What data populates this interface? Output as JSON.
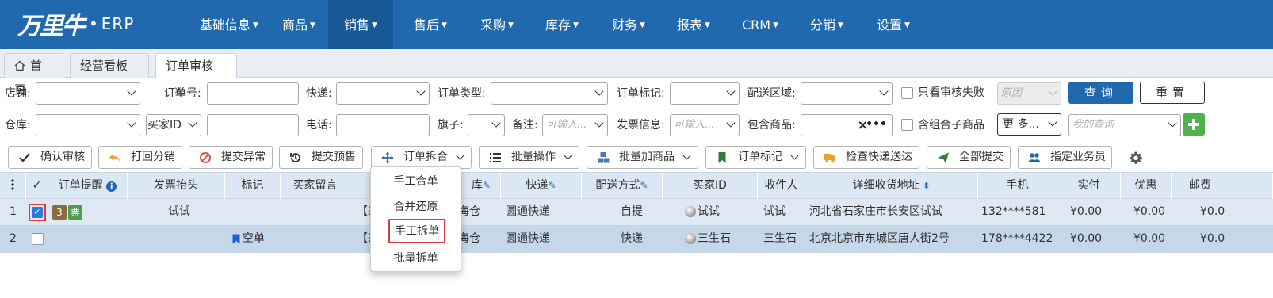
{
  "brand": {
    "logo": "万里牛",
    "product": "ERP"
  },
  "nav": {
    "items": [
      {
        "label": "基础信息"
      },
      {
        "label": "商品"
      },
      {
        "label": "销售"
      },
      {
        "label": "售后"
      },
      {
        "label": "采购"
      },
      {
        "label": "库存"
      },
      {
        "label": "财务"
      },
      {
        "label": "报表"
      },
      {
        "label": "CRM"
      },
      {
        "label": "分销"
      },
      {
        "label": "设置"
      }
    ],
    "active": "销售",
    "color": "#2169ae"
  },
  "tabs": [
    {
      "label": "首页",
      "icon": "home-icon"
    },
    {
      "label": "经营看板",
      "closable": true
    },
    {
      "label": "订单审核",
      "closable": true,
      "active": true
    }
  ],
  "filters": {
    "shop_label": "店铺:",
    "order_no_label": "订单号:",
    "express_label": "快递:",
    "order_type_label": "订单类型:",
    "order_mark_label": "订单标记:",
    "region_label": "配送区域:",
    "only_failed_label": "只看审核失败",
    "reason_placeholder": "原因",
    "warehouse_label": "仓库:",
    "buyer_select": "买家ID",
    "phone_label": "电话:",
    "flag_label": "旗子:",
    "remark_label": "备注:",
    "remark_placeholder": "可输入...",
    "invoice_label": "发票信息:",
    "invoice_placeholder": "可输入...",
    "contains_goods_label": "包含商品:",
    "combo_label": "含组合子商品",
    "more_select": "更 多...",
    "my_query_placeholder": "我的查询",
    "query_button": "查询",
    "reset_button": "重置"
  },
  "toolbar": {
    "confirm": "确认审核",
    "back": "打回分销",
    "exception": "提交异常",
    "presale": "提交预售",
    "split_merge": "订单拆合",
    "batch_ops": "批量操作",
    "batch_add": "批量加商品",
    "order_mark": "订单标记",
    "check_express": "检查快递送达",
    "submit_all": "全部提交",
    "assign_sales": "指定业务员"
  },
  "dropdown": {
    "items": [
      "手工合单",
      "合并还原",
      "手工拆单",
      "批量拆单"
    ],
    "highlighted": "手工拆单"
  },
  "table": {
    "headers": {
      "reminder": "订单提醒",
      "invoice_title": "发票抬头",
      "mark": "标记",
      "buyer_msg": "买家留言",
      "warehouse_suffix": "库",
      "express": "快递",
      "delivery": "配送方式",
      "buyer_id": "买家ID",
      "receiver": "收件人",
      "address": "详细收货地址",
      "mobile": "手机",
      "paid": "实付",
      "discount": "优惠",
      "postage": "邮费"
    },
    "rows": [
      {
        "index": "1",
        "checked": true,
        "reminder_count": "3",
        "reminder_tag": "票",
        "invoice_title": "试试",
        "mark": "",
        "buyer_msg_prefix": "【来",
        "warehouse": "海仓",
        "express": "圆通快递",
        "delivery": "自提",
        "buyer_id": "试试",
        "receiver": "试试",
        "address": "河北省石家庄市长安区试试",
        "mobile": "132****581",
        "paid": "¥0.00",
        "discount": "¥0.00",
        "postage": "¥0.0"
      },
      {
        "index": "2",
        "checked": false,
        "reminder_count": "",
        "reminder_tag": "",
        "invoice_title": "",
        "mark": "空单",
        "buyer_msg_prefix": "【来",
        "warehouse": "海仓",
        "express": "圆通快递",
        "delivery": "快递",
        "buyer_id": "三生石",
        "receiver": "三生石",
        "address": "北京北京市东城区唐人街2号",
        "mobile": "178****4422",
        "paid": "¥0.00",
        "discount": "¥0.00",
        "postage": "¥0.0"
      }
    ]
  }
}
